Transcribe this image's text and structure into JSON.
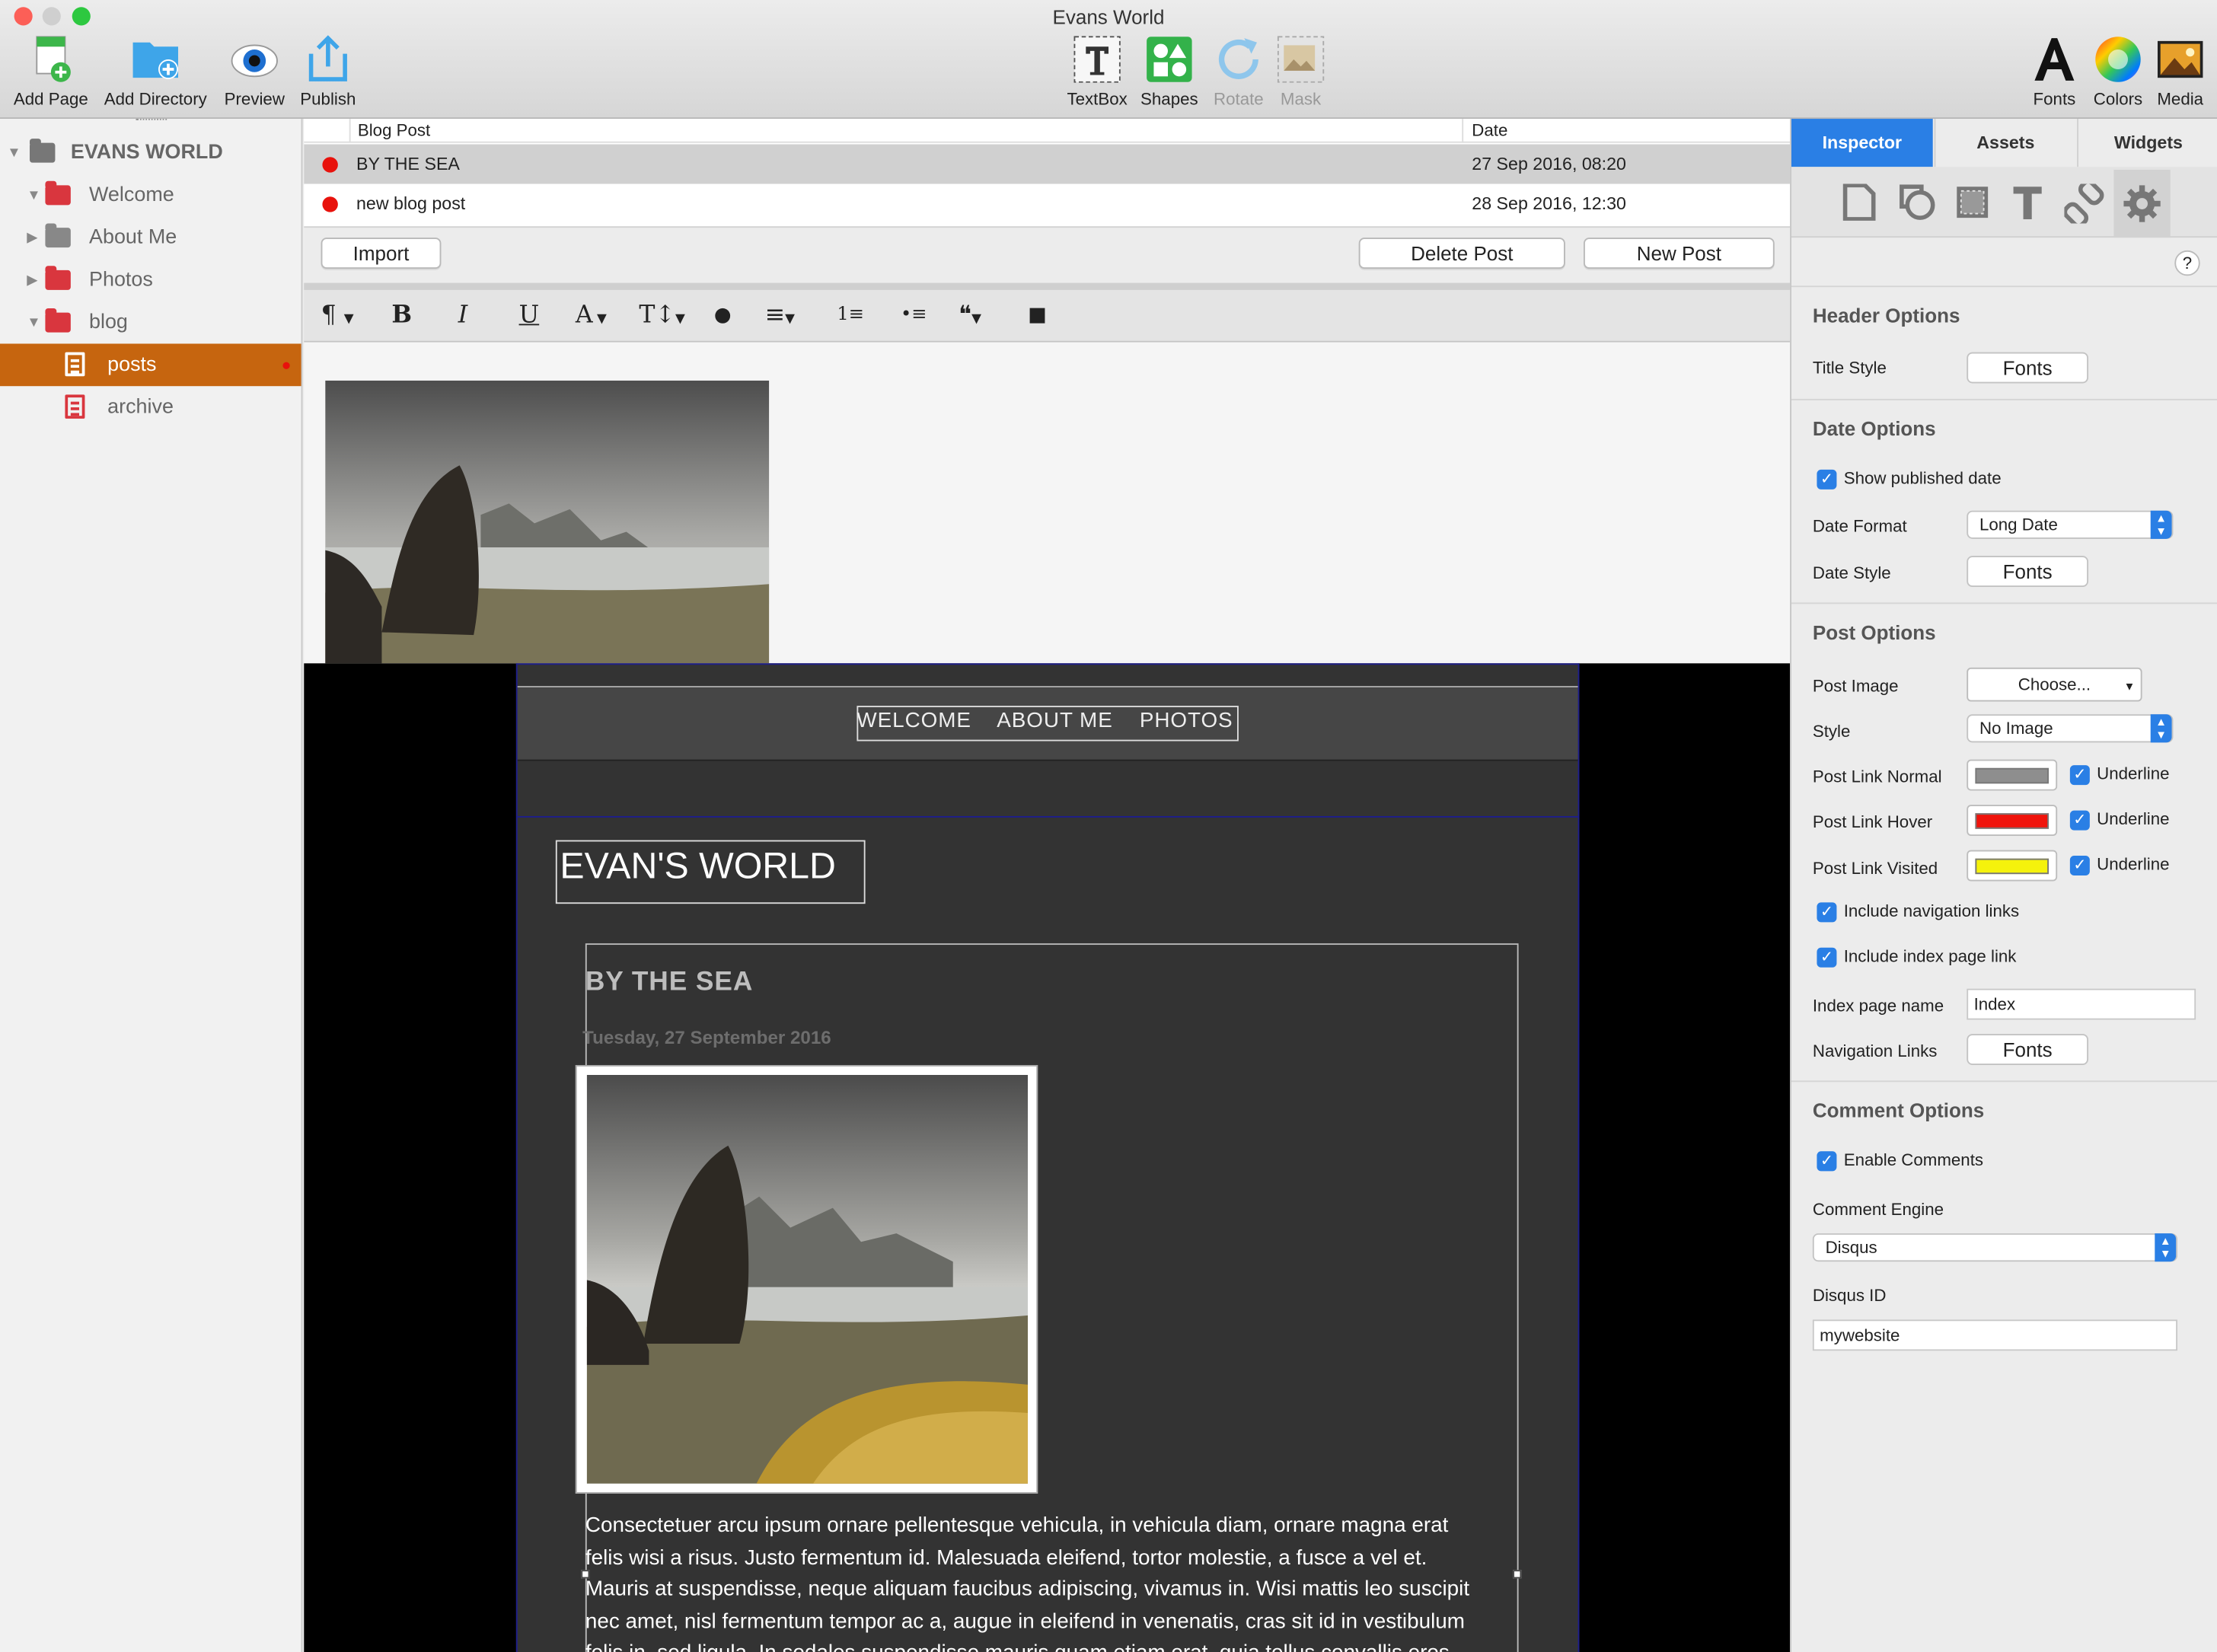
{
  "window": {
    "title": "Evans World"
  },
  "toolbar": {
    "left": [
      {
        "label": "Add Page",
        "icon": "add-page-icon"
      },
      {
        "label": "Add Directory",
        "icon": "add-directory-icon"
      },
      {
        "label": "Preview",
        "icon": "preview-eye-icon"
      },
      {
        "label": "Publish",
        "icon": "publish-icon"
      }
    ],
    "center": [
      {
        "label": "TextBox",
        "icon": "textbox-icon",
        "enabled": true
      },
      {
        "label": "Shapes",
        "icon": "shapes-icon",
        "enabled": true
      },
      {
        "label": "Rotate",
        "icon": "rotate-icon",
        "enabled": false
      },
      {
        "label": "Mask",
        "icon": "mask-icon",
        "enabled": false
      }
    ],
    "right": [
      {
        "label": "Fonts",
        "icon": "fonts-icon"
      },
      {
        "label": "Colors",
        "icon": "colors-icon"
      },
      {
        "label": "Media",
        "icon": "media-icon"
      }
    ]
  },
  "sidebar": {
    "root": "EVANS WORLD",
    "items": [
      {
        "label": "Welcome",
        "type": "folder",
        "expanded": true
      },
      {
        "label": "About Me",
        "type": "folder",
        "expanded": false
      },
      {
        "label": "Photos",
        "type": "folder",
        "expanded": false
      },
      {
        "label": "blog",
        "type": "folder",
        "expanded": true
      },
      {
        "label": "posts",
        "type": "page",
        "selected": true
      },
      {
        "label": "archive",
        "type": "page",
        "selected": false
      }
    ]
  },
  "post_list": {
    "columns": [
      "Blog Post",
      "Date"
    ],
    "rows": [
      {
        "title": "BY THE SEA",
        "date": "27 Sep 2016, 08:20",
        "selected": true
      },
      {
        "title": "new blog post",
        "date": "28 Sep 2016, 12:30",
        "selected": false
      }
    ],
    "buttons": {
      "import": "Import",
      "delete": "Delete Post",
      "new": "New Post"
    }
  },
  "format_bar": {
    "paragraph": "¶",
    "bold": "B",
    "italic": "I",
    "underline": "U",
    "font": "A",
    "size": "T↕",
    "color": "●",
    "align": "≡",
    "ordered_list": "1≡",
    "bullet_list": "•≡",
    "quote": "❝",
    "video": "■"
  },
  "preview": {
    "nav": [
      "WELCOME",
      "ABOUT ME",
      "PHOTOS"
    ],
    "site_title": "EVAN'S WORLD",
    "post_title": "BY THE SEA",
    "post_date": "Tuesday, 27 September 2016",
    "body_lines": [
      "Consectetuer arcu ipsum ornare pellentesque vehicula, in vehicula diam, ornare magna erat",
      "felis wisi a risus. Justo fermentum id. Malesuada eleifend, tortor molestie, a fusce a vel et.",
      "Mauris at suspendisse, neque aliquam faucibus adipiscing, vivamus in. Wisi mattis leo suscipit",
      "nec amet, nisl fermentum tempor ac a, augue in eleifend in venenatis, cras sit id in vestibulum",
      "felis in, sed ligula. In sodales suspendisse mauris quam etiam erat, quia tellus convallis eros"
    ]
  },
  "inspector": {
    "tabs": [
      "Inspector",
      "Assets",
      "Widgets"
    ],
    "active_tab": "Inspector",
    "help": "?",
    "header_options": {
      "heading": "Header Options",
      "title_style_label": "Title Style",
      "title_style_btn": "Fonts"
    },
    "date_options": {
      "heading": "Date Options",
      "show_published": "Show published date",
      "date_format_label": "Date Format",
      "date_format_value": "Long Date",
      "date_style_label": "Date Style",
      "date_style_btn": "Fonts"
    },
    "post_options": {
      "heading": "Post Options",
      "post_image_label": "Post Image",
      "post_image_value": "Choose...",
      "style_label": "Style",
      "style_value": "No Image",
      "link_normal_label": "Post Link Normal",
      "link_hover_label": "Post Link Hover",
      "link_visited_label": "Post Link Visited",
      "underline": "Underline",
      "colors": {
        "normal": "#8e8e8e",
        "hover": "#f0140c",
        "visited": "#f5f20c"
      },
      "include_nav": "Include navigation links",
      "include_index": "Include index page link",
      "index_name_label": "Index page name",
      "index_name_value": "Index",
      "nav_links_label": "Navigation Links",
      "nav_links_btn": "Fonts"
    },
    "comment_options": {
      "heading": "Comment Options",
      "enable": "Enable Comments",
      "engine_label": "Comment Engine",
      "engine_value": "Disqus",
      "disqus_label": "Disqus ID",
      "disqus_value": "mywebsite"
    }
  },
  "accent": "#2a7fe5",
  "selection": "#c6650f"
}
